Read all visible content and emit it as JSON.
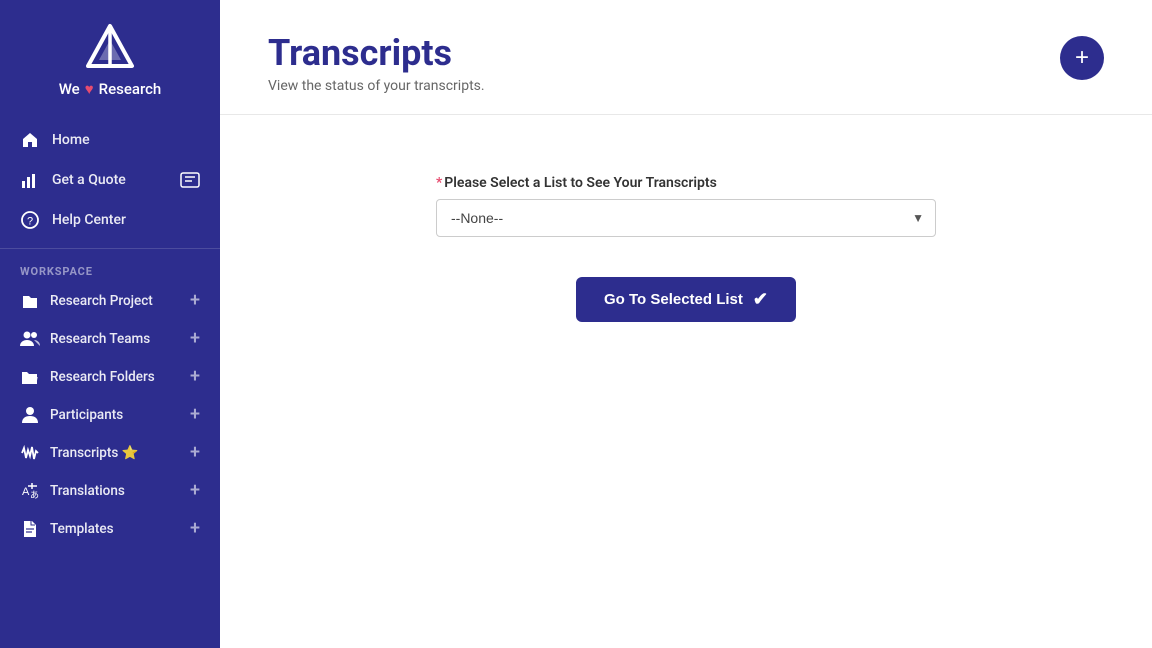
{
  "brand": {
    "logo_alt": "We Love Research Logo",
    "name_prefix": "We",
    "heart": "♥",
    "name_suffix": "Research"
  },
  "sidebar": {
    "nav_items": [
      {
        "id": "home",
        "label": "Home",
        "icon": "home"
      },
      {
        "id": "get-a-quote",
        "label": "Get a Quote",
        "icon": "chart"
      },
      {
        "id": "help-center",
        "label": "Help Center",
        "icon": "question"
      }
    ],
    "workspace_label": "WORKSPACE",
    "workspace_items": [
      {
        "id": "research-project",
        "label": "Research Project",
        "icon": "folder",
        "has_plus": true
      },
      {
        "id": "research-teams",
        "label": "Research Teams",
        "icon": "people",
        "has_plus": true
      },
      {
        "id": "research-folders",
        "label": "Research Folders",
        "icon": "folder-open",
        "has_plus": true
      },
      {
        "id": "participants",
        "label": "Participants",
        "icon": "person",
        "has_plus": true
      },
      {
        "id": "transcripts",
        "label": "Transcripts ⭐",
        "icon": "waveform",
        "has_plus": true
      },
      {
        "id": "translations",
        "label": "Translations",
        "icon": "translate",
        "has_plus": true
      },
      {
        "id": "templates",
        "label": "Templates",
        "icon": "file",
        "has_plus": true
      }
    ]
  },
  "main": {
    "title": "Transcripts",
    "subtitle": "View the status of your transcripts.",
    "add_button_label": "+",
    "form": {
      "field_label": "Please Select a List to See Your Transcripts",
      "required": true,
      "dropdown_default": "--None--",
      "dropdown_options": [
        "--None--"
      ],
      "go_button_label": "Go To Selected List",
      "go_button_icon": "✔"
    }
  }
}
